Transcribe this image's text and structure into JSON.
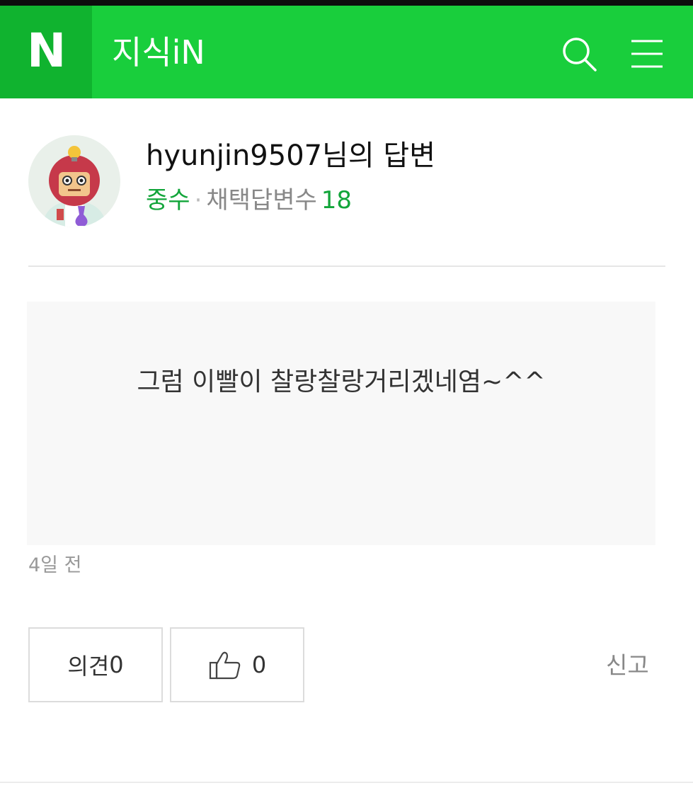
{
  "header": {
    "logo_text": "N",
    "app_title": "지식iN",
    "search_icon": "search-icon",
    "menu_icon": "menu-icon",
    "brand_color": "#19ce3c",
    "logo_box_color": "#10b32f"
  },
  "answer": {
    "title": "hyunjin9507님의 답변",
    "level": "중수",
    "separator": "·",
    "adopted_label": "채택답변수",
    "adopted_count": "18",
    "content": "그럼 이빨이 찰랑찰랑거리겠네염~^^",
    "date": "4일 전"
  },
  "actions": {
    "opinion_label": "의견",
    "opinion_count": "0",
    "like_count": "0",
    "like_icon": "thumbs-up-icon",
    "report_label": "신고"
  }
}
